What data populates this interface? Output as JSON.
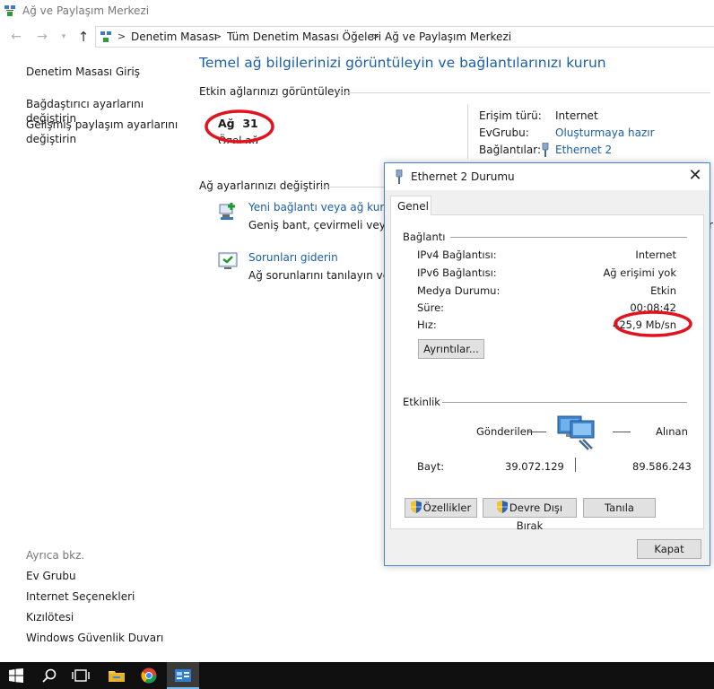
{
  "window": {
    "title": "Ağ ve Paylaşım Merkezi"
  },
  "address_bar": {
    "crumbs": [
      "Denetim Masası",
      "Tüm Denetim Masası Öğeleri",
      "Ağ ve Paylaşım Merkezi"
    ],
    "separator": ">"
  },
  "left_pane": {
    "home": "Denetim Masası Giriş",
    "adapter_settings": "Bağdaştırıcı ayarlarını değiştirin",
    "sharing_line1": "Gelişmiş paylaşım ayarlarını",
    "sharing_line2": "değiştirin",
    "see_also": "Ayrıca bkz.",
    "see_also_items": [
      "Ev Grubu",
      "Internet Seçenekleri",
      "Kızılötesi",
      "Windows Güvenlik Duvarı"
    ]
  },
  "main": {
    "heading": "Temel ağ bilgilerinizi görüntüleyin ve bağlantılarınızı kurun",
    "active_networks_title": "Etkin ağlarınızı görüntüleyin",
    "network_name": "Ağ  31",
    "network_type": "Özel ağ",
    "access_type_label": "Erişim türü:",
    "access_type_value": "Internet",
    "homegroup_label": "EvGrubu:",
    "homegroup_value": "Oluşturmaya hazır",
    "connections_label": "Bağlantılar:",
    "connections_value": "Ethernet 2",
    "change_settings_title": "Ağ ayarlarınızı değiştirin",
    "new_connection_link": "Yeni bağlantı veya ağ kurun",
    "new_connection_desc": "Geniş bant, çevirmeli veya VP",
    "troubleshoot_link": "Sorunları giderin",
    "troubleshoot_desc": "Ağ sorunlarını tanılayın ve on",
    "truncated_right_char": "r"
  },
  "dialog": {
    "title": "Ethernet 2 Durumu",
    "close": "✕",
    "tab": "Genel",
    "connection_section": "Bağlantı",
    "rows": [
      {
        "label": "IPv4 Bağlantısı:",
        "value": "Internet"
      },
      {
        "label": "IPv6 Bağlantısı:",
        "value": "Ağ erişimi yok"
      },
      {
        "label": "Medya Durumu:",
        "value": "Etkin"
      },
      {
        "label": "Süre:",
        "value": "00:08:42"
      },
      {
        "label": "Hız:",
        "value": "425,9 Mb/sn"
      }
    ],
    "details_button": "Ayrıntılar...",
    "activity_section": "Etkinlik",
    "sent_label": "Gönderilen",
    "received_label": "Alınan",
    "bytes_label": "Bayt:",
    "bytes_sent": "39.072.129",
    "bytes_received": "89.586.243",
    "properties_button": "Özellikler",
    "disable_button": "Devre Dışı Bırak",
    "diagnose_button": "Tanıla",
    "close_button": "Kapat"
  },
  "colors": {
    "link": "#1a5fa6",
    "heading": "#1b5fa6",
    "annotation_red": "#e0141e",
    "taskbar": "#101010",
    "dialog_border": "#4a86c8"
  },
  "taskbar": {
    "icons": [
      "windows-start-icon",
      "search-icon",
      "task-view-icon",
      "file-explorer-icon",
      "chrome-icon",
      "control-panel-app-icon"
    ]
  }
}
